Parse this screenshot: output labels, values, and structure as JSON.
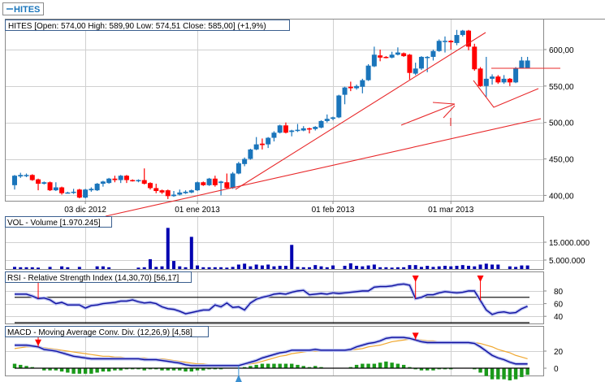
{
  "symbol_tab": {
    "label": "HITES"
  },
  "colors": {
    "up": "#1a75bb",
    "down": "#ff0000",
    "rsi": "#1010a0",
    "macd": "#1010a0",
    "signal": "#f0a830",
    "hist": "#1a9a1a",
    "volume": "#0000b0",
    "trend": "#e8282a"
  },
  "chart_data": [
    {
      "type": "candlestick",
      "title": "HITES [Open: 574,00  High: 589,90  Low: 574,51  Close: 585,00] (+1,9%)",
      "x_tick_labels": [
        "03 dic 2012",
        "01 ene 2013",
        "01 feb 2013",
        "01 mar 2013"
      ],
      "x_tick_index": [
        12,
        31,
        54,
        74
      ],
      "y_tick_labels": [
        "600,00",
        "550,00",
        "500,00",
        "450,00",
        "400,00"
      ],
      "y_ticks": [
        600,
        550,
        500,
        450,
        400
      ],
      "ylim": [
        393,
        628
      ],
      "grid": true,
      "ohlc": [
        [
          414,
          428,
          408,
          427
        ],
        [
          426,
          431,
          424,
          428
        ],
        [
          427,
          430,
          425,
          428
        ],
        [
          428,
          429,
          420,
          421
        ],
        [
          422,
          423,
          407,
          416
        ],
        [
          416,
          419,
          415,
          418
        ],
        [
          418,
          419,
          406,
          407
        ],
        [
          407,
          418,
          406,
          411
        ],
        [
          411,
          412,
          401,
          403
        ],
        [
          403,
          405,
          403,
          404
        ],
        [
          404,
          409,
          402,
          405
        ],
        [
          408,
          409,
          396,
          397
        ],
        [
          397,
          409,
          396,
          408
        ],
        [
          407,
          411,
          405,
          409
        ],
        [
          407,
          417,
          406,
          416
        ],
        [
          416,
          420,
          412,
          419
        ],
        [
          417,
          424,
          416,
          423
        ],
        [
          423,
          427,
          418,
          421
        ],
        [
          421,
          428,
          417,
          427
        ],
        [
          427,
          428,
          417,
          421
        ],
        [
          421,
          422,
          419,
          420
        ],
        [
          420,
          422,
          418,
          421
        ],
        [
          421,
          437,
          415,
          416
        ],
        [
          417,
          418,
          408,
          410
        ],
        [
          410,
          416,
          403,
          406
        ],
        [
          407,
          408,
          402,
          404
        ],
        [
          407,
          408,
          395,
          399
        ],
        [
          399,
          406,
          398,
          401
        ],
        [
          401,
          408,
          400,
          404
        ],
        [
          403,
          407,
          402,
          405
        ],
        [
          404,
          408,
          403,
          407
        ],
        [
          407,
          419,
          406,
          418
        ],
        [
          418,
          419,
          413,
          414
        ],
        [
          414,
          424,
          413,
          423
        ],
        [
          423,
          427,
          412,
          414
        ],
        [
          417,
          420,
          400,
          419
        ],
        [
          418,
          430,
          409,
          410
        ],
        [
          410,
          432,
          409,
          430
        ],
        [
          430,
          446,
          429,
          444
        ],
        [
          443,
          452,
          440,
          450
        ],
        [
          450,
          464,
          449,
          463
        ],
        [
          463,
          480,
          462,
          470
        ],
        [
          471,
          478,
          463,
          469
        ],
        [
          470,
          480,
          465,
          479
        ],
        [
          479,
          488,
          474,
          486
        ],
        [
          486,
          497,
          485,
          496
        ],
        [
          496,
          500,
          485,
          486
        ],
        [
          487,
          490,
          481,
          489
        ],
        [
          489,
          498,
          487,
          490
        ],
        [
          489,
          495,
          488,
          492
        ],
        [
          492,
          493,
          485,
          491
        ],
        [
          491,
          495,
          489,
          494
        ],
        [
          493,
          503,
          492,
          502
        ],
        [
          502,
          511,
          500,
          505
        ],
        [
          505,
          508,
          503,
          507
        ],
        [
          507,
          538,
          506,
          537
        ],
        [
          538,
          549,
          525,
          548
        ],
        [
          549,
          556,
          543,
          547
        ],
        [
          547,
          552,
          545,
          550
        ],
        [
          549,
          560,
          540,
          558
        ],
        [
          558,
          580,
          557,
          578
        ],
        [
          577,
          604,
          576,
          593
        ],
        [
          592,
          600,
          584,
          589
        ],
        [
          590,
          591,
          588,
          589
        ],
        [
          589,
          597,
          588,
          593
        ],
        [
          593,
          603,
          592,
          596
        ],
        [
          595,
          596,
          590,
          591
        ],
        [
          593,
          594,
          559,
          568
        ],
        [
          567,
          582,
          565,
          574
        ],
        [
          574,
          591,
          572,
          590
        ],
        [
          589,
          591,
          569,
          590
        ],
        [
          590,
          600,
          585,
          598
        ],
        [
          598,
          614,
          597,
          612
        ],
        [
          611,
          618,
          596,
          612
        ],
        [
          612,
          613,
          600,
          610
        ],
        [
          609,
          627,
          606,
          620
        ],
        [
          620,
          627,
          618,
          626
        ],
        [
          626,
          627,
          599,
          604
        ],
        [
          604,
          608,
          571,
          573
        ],
        [
          574,
          576,
          549,
          550
        ],
        [
          550,
          590,
          535,
          560
        ],
        [
          560,
          566,
          552,
          563
        ],
        [
          563,
          565,
          553,
          555
        ],
        [
          555,
          565,
          553,
          560
        ],
        [
          560,
          561,
          550,
          555
        ],
        [
          555,
          576,
          554,
          574
        ],
        [
          574,
          590,
          574,
          585
        ],
        [
          574,
          590,
          574,
          585
        ]
      ]
    },
    {
      "type": "bar",
      "title": "VOL - Volume [1.970.245]",
      "y_tick_labels": [
        "15.000.000",
        "5.000.000"
      ],
      "y_ticks": [
        15,
        5
      ],
      "units": "millions",
      "values": [
        1.2,
        1,
        1,
        1,
        0.8,
        0,
        1.2,
        0,
        1.5,
        1,
        0,
        1.2,
        0,
        0,
        1.5,
        1.5,
        1,
        0,
        0,
        0,
        0,
        0.8,
        1,
        5.5,
        1.2,
        1.5,
        23,
        4.5,
        1.5,
        1,
        18,
        2,
        1,
        1,
        1,
        1,
        0.8,
        1.2,
        2.5,
        3,
        1.5,
        2.5,
        2,
        2.5,
        1.5,
        1.8,
        1.8,
        13.5,
        1.2,
        1,
        1,
        2.2,
        1.5,
        1,
        2,
        0,
        1.8,
        3.2,
        1.8,
        1.5,
        2,
        2.5,
        1,
        1,
        0.8,
        1,
        1,
        2.2,
        2.2,
        1.2,
        1.8,
        1.2,
        1.5,
        1.8,
        1.5,
        1.8,
        2.2,
        1.8,
        1.5,
        2.5,
        3,
        2.5,
        2.5,
        0,
        1.5,
        1.2,
        2,
        2
      ]
    },
    {
      "type": "line",
      "title": "RSI - Relative Strength Index (14,30,70) [56,17]",
      "y_tick_labels": [
        "80",
        "60",
        "40"
      ],
      "y_ticks": [
        80,
        60,
        40
      ],
      "levels": [
        70,
        30
      ],
      "signals_down": [
        4,
        68,
        79
      ],
      "values": [
        75,
        75,
        75,
        72,
        68,
        69,
        66,
        60,
        62,
        58,
        58,
        58,
        53,
        57,
        58,
        60,
        61,
        62,
        64,
        64,
        66,
        63,
        61,
        62,
        60,
        55,
        52,
        51,
        48,
        44,
        46,
        48,
        50,
        50,
        58,
        55,
        61,
        54,
        55,
        50,
        61,
        67,
        70,
        72,
        75,
        76,
        75,
        78,
        80,
        81,
        74,
        75,
        76,
        75,
        77,
        76,
        77,
        78,
        79,
        80,
        80,
        86,
        87,
        87,
        88,
        90,
        91,
        89,
        68,
        70,
        74,
        74,
        77,
        79,
        78,
        77,
        78,
        80,
        80,
        65,
        50,
        43,
        46,
        47,
        45,
        46,
        52,
        56
      ]
    },
    {
      "type": "line",
      "title": "MACD - Moving Average Conv. Div. (12,26,9) [4,58]",
      "y_tick_labels": [
        "20",
        "0"
      ],
      "y_ticks": [
        20,
        0
      ],
      "signals_down": [
        4,
        68
      ],
      "signals_up": [
        38
      ],
      "series": [
        {
          "name": "MACD",
          "values": [
            27,
            27,
            27,
            26,
            25,
            22,
            21,
            20,
            18,
            16,
            14,
            13,
            12,
            11,
            11,
            11,
            11,
            11,
            11,
            11,
            11,
            11,
            10,
            10,
            10,
            9,
            8,
            7,
            6,
            4,
            3,
            3,
            3,
            3,
            3,
            3,
            3,
            3,
            3,
            5,
            7,
            9,
            12,
            14,
            16,
            18,
            19,
            21,
            21,
            21,
            21,
            22,
            21,
            21,
            21,
            21,
            21,
            22,
            25,
            27,
            29,
            30,
            32,
            35,
            36,
            36,
            36,
            35,
            33,
            31,
            30,
            30,
            30,
            30,
            30,
            30,
            30,
            30,
            29,
            25,
            20,
            15,
            12,
            10,
            7,
            5,
            5,
            5
          ]
        },
        {
          "name": "Signal",
          "values": [
            23,
            24,
            25,
            25,
            25,
            24,
            23,
            22,
            21,
            20,
            19,
            18,
            17,
            16,
            15,
            14,
            14,
            13,
            13,
            12,
            12,
            12,
            12,
            11,
            11,
            11,
            10,
            9,
            8,
            7,
            6,
            5,
            5,
            4,
            4,
            4,
            3,
            3,
            3,
            4,
            5,
            6,
            8,
            10,
            12,
            14,
            15,
            17,
            18,
            19,
            20,
            20,
            20,
            21,
            21,
            21,
            21,
            21,
            22,
            23,
            25,
            26,
            27,
            29,
            31,
            32,
            33,
            34,
            34,
            33,
            32,
            32,
            31,
            31,
            31,
            30,
            30,
            30,
            30,
            29,
            27,
            25,
            22,
            20,
            18,
            15,
            13,
            11
          ]
        }
      ]
    }
  ]
}
